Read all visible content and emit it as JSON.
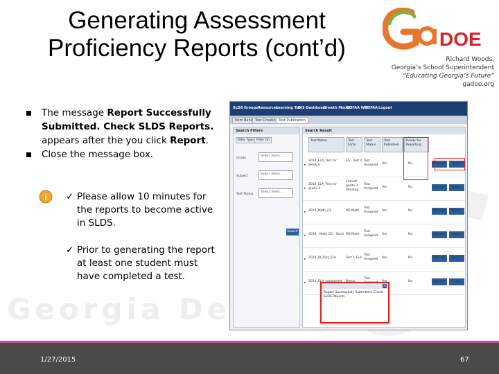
{
  "slide": {
    "title_line1": "Generating Assessment",
    "title_line2": "Proficiency Reports (cont’d)",
    "logo": {
      "wordmark": "GaDOE",
      "name": "Richard Woods,",
      "role": "Georgia’s School Superintendent",
      "motto": "“Educating Georgia’s Future”",
      "url": "gadoe.org",
      "colors": {
        "green": "#7cb342",
        "orange": "#e8772e",
        "red": "#d8232a"
      }
    },
    "bullets": [
      {
        "text_before": "The message ",
        "bold": "Report Successfully Submitted. Check SLDS Reports.",
        "text_after": " appears after the you click ",
        "bold2": "Report",
        "text_end": "."
      },
      {
        "text": "Close the message box."
      }
    ],
    "info_icon": "info-icon",
    "checks": [
      "Please allow 10 minutes for the reports to become active in SLDS.",
      "Prior to generating the report at least one student must have completed a test."
    ],
    "watermark": "Georgia Depart",
    "footer": {
      "date": "1/27/2015",
      "page": "67"
    }
  },
  "screenshot": {
    "nav": [
      "SLDS",
      "Groups",
      "Resources",
      "Learning Tool",
      "DIS Dashboard",
      "Growth Model",
      "GOFAA WIC",
      "GOFAA",
      "Logout"
    ],
    "tabs": [
      "Item Bank",
      "Test Creation",
      "Test Publication"
    ],
    "filters": {
      "title": "Search Filters",
      "col1": "Filter Type",
      "col2": "Filter On",
      "rows": [
        {
          "label": "Grade",
          "value": "Select items..."
        },
        {
          "label": "Subject",
          "value": "Select items..."
        },
        {
          "label": "Test Status",
          "value": "Select items..."
        }
      ],
      "search_button": "Search"
    },
    "results": {
      "title": "Search Result",
      "columns": [
        "Test Name",
        "Test Form",
        "Test Status",
        "Test Published",
        "Ready for Reporting"
      ],
      "rows": [
        {
          "name": "2014_ELA_Test for Week 4",
          "form": "ES - Test 2",
          "status": "Test Assigned",
          "published": "Yes",
          "ready": "No"
        },
        {
          "name": "2014_ELA_Test for grade 3",
          "form": "Extract grade 3 Reading",
          "status": "Test Assigned",
          "published": "Yes",
          "ready": "No"
        },
        {
          "name": "2014_Math_G5",
          "form": "MS Math",
          "status": "Test Assigned",
          "published": "Yes",
          "ready": "No"
        },
        {
          "name": "2014 - Math G5 - Sand",
          "form": "MS Math",
          "status": "Test Assigned",
          "published": "Yes",
          "ready": "No"
        },
        {
          "name": "2014_IB_Test_ELA",
          "form": "Test 1 ELA",
          "status": "Test Assigned",
          "published": "Yes",
          "ready": "No"
        },
        {
          "name": "2014_ELA_completed",
          "form": "Demo",
          "status": "Test Assigned",
          "published": "Yes",
          "ready": "No"
        }
      ],
      "manage_button": "Manage",
      "report_button": "Report"
    },
    "popup": {
      "message": "Report Successfully Submitted. Check SLDS Reports."
    }
  }
}
